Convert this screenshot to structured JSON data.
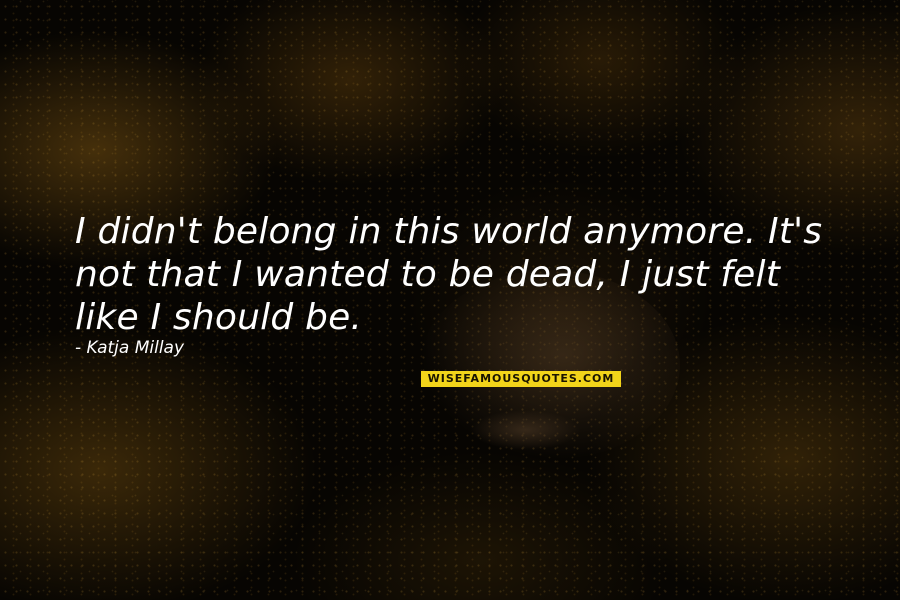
{
  "quote": {
    "lines": [
      "I didn't belong in this world anymore. It's",
      "not that I wanted to be dead, I just felt",
      "like I should be."
    ],
    "author": "- Katja Millay"
  },
  "watermark": {
    "text": "WISEFAMOUSQUOTES.COM"
  },
  "colors": {
    "text": "#ffffff",
    "background": "#050402",
    "glow": "#7a5212",
    "watermark_bg": "#f2d41a"
  }
}
